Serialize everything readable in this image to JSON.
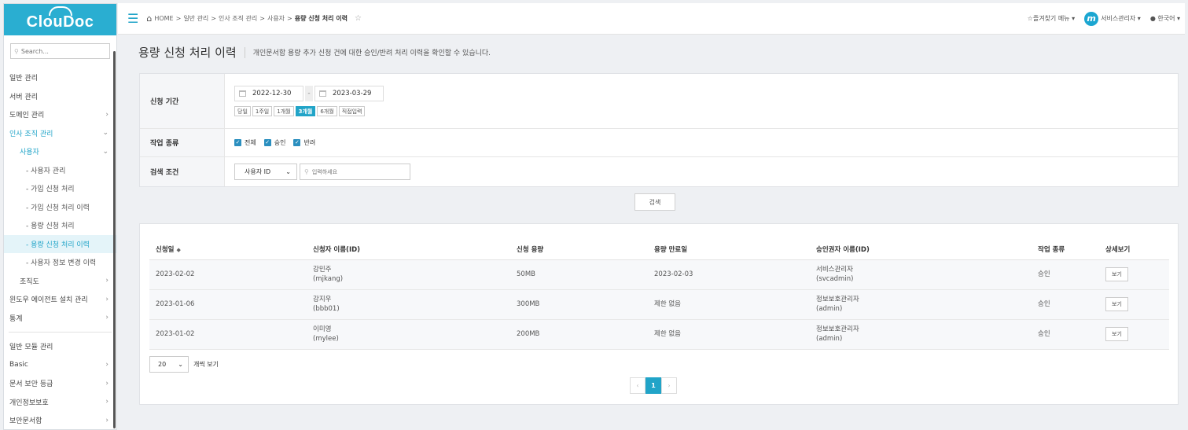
{
  "app": {
    "logo": "ClouDoc"
  },
  "sidebar": {
    "search_placeholder": "Search...",
    "items": [
      {
        "label": "일반 관리",
        "type": "section"
      },
      {
        "label": "서버 관리",
        "type": "item"
      },
      {
        "label": "도메인 관리",
        "type": "item",
        "chevron": "›"
      },
      {
        "label": "인사 조직 관리",
        "type": "active",
        "chevron": "⌄"
      },
      {
        "label": "사용자",
        "type": "sub",
        "chevron": "⌄"
      },
      {
        "label": "- 사용자 관리",
        "type": "subsub"
      },
      {
        "label": "- 가입 신청 처리",
        "type": "subsub"
      },
      {
        "label": "- 가입 신청 처리 이력",
        "type": "subsub"
      },
      {
        "label": "- 용량 신청 처리",
        "type": "subsub"
      },
      {
        "label": "- 용량 신청 처리 이력",
        "type": "selected"
      },
      {
        "label": "- 사용자 정보 변경 이력",
        "type": "subsub"
      },
      {
        "label": "조직도",
        "type": "level2",
        "chevron": "›"
      },
      {
        "label": "윈도우 에이전트 설치 관리",
        "type": "item",
        "chevron": "›"
      },
      {
        "label": "통계",
        "type": "item",
        "chevron": "›"
      },
      {
        "label": "일반 모듈 관리",
        "type": "section"
      },
      {
        "label": "Basic",
        "type": "item",
        "chevron": "›"
      },
      {
        "label": "문서 보안 등급",
        "type": "item",
        "chevron": "›"
      },
      {
        "label": "개인정보보호",
        "type": "item",
        "chevron": "›"
      },
      {
        "label": "보안문서함",
        "type": "item",
        "chevron": "›"
      }
    ]
  },
  "topbar": {
    "breadcrumb": [
      "HOME",
      "일반 관리",
      "인사 조직 관리",
      "사용자"
    ],
    "breadcrumb_current": "용량 신청 처리 이력",
    "favorites": "즐겨찾기 메뉴 ▾",
    "admin": "서비스관리자 ▾",
    "language": "한국어 ▾"
  },
  "page": {
    "title": "용량 신청 처리 이력",
    "description": "개인문서함 용량 추가 신청 건에 대한 승인/반려 처리 이력을 확인할 수 있습니다."
  },
  "filters": {
    "period_label": "신청 기간",
    "date_from": "2022-12-30",
    "date_to": "2023-03-29",
    "date_sep": "-",
    "periods": [
      "당일",
      "1주일",
      "1개월",
      "3개월",
      "6개월",
      "직접입력"
    ],
    "period_active": "3개월",
    "type_label": "작업 종류",
    "types": [
      "전체",
      "승인",
      "반려"
    ],
    "cond_label": "검색 조건",
    "cond_select": "사용자 ID",
    "cond_placeholder": "입력하세요"
  },
  "search_button": "검색",
  "table": {
    "columns": [
      "신청일",
      "신청자 이름(ID)",
      "신청 용량",
      "용량 만료일",
      "승인권자 이름(ID)",
      "작업 종류",
      "상세보기"
    ],
    "rows": [
      {
        "date": "2023-02-02",
        "name": "강민주",
        "id": "(mjkang)",
        "size": "50MB",
        "expire": "2023-02-03",
        "approver": "서비스관리자",
        "approver_id": "(svcadmin)",
        "type": "승인",
        "view": "보기"
      },
      {
        "date": "2023-01-06",
        "name": "강지우",
        "id": "(bbb01)",
        "size": "300MB",
        "expire": "제한 없음",
        "approver": "정보보호관리자",
        "approver_id": "(admin)",
        "type": "승인",
        "view": "보기"
      },
      {
        "date": "2023-01-02",
        "name": "이미영",
        "id": "(mylee)",
        "size": "200MB",
        "expire": "제한 없음",
        "approver": "정보보호관리자",
        "approver_id": "(admin)",
        "type": "승인",
        "view": "보기"
      }
    ]
  },
  "pagination": {
    "page_size": "20",
    "page_size_suffix": "개씩 보기",
    "prev": "‹",
    "current": "1",
    "next": "›"
  },
  "colors": {
    "accent": "#21a4c8",
    "logo_bg": "#2aaed1"
  }
}
